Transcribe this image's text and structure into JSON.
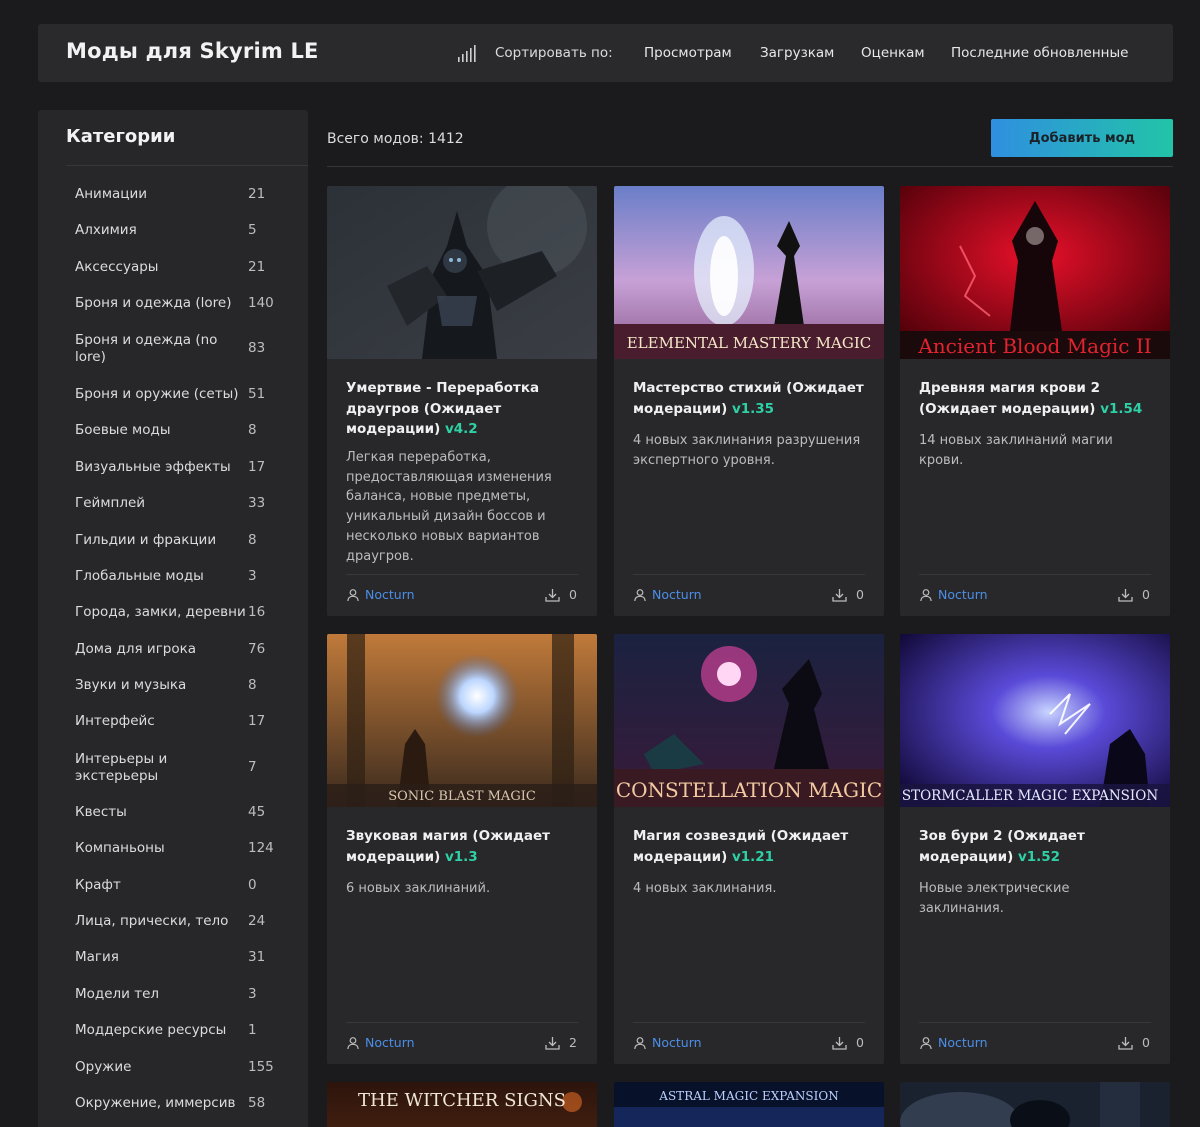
{
  "header": {
    "title": "Моды для Skyrim LE",
    "sort_label": "Сортировать по:",
    "sort_options": [
      "Просмотрам",
      "Загрузкам",
      "Оценкам",
      "Последние обновленные"
    ]
  },
  "sidebar": {
    "title": "Категории",
    "categories": [
      {
        "label": "Анимации",
        "count": "21"
      },
      {
        "label": "Алхимия",
        "count": "5"
      },
      {
        "label": "Аксессуары",
        "count": "21"
      },
      {
        "label": "Броня и одежда (lore)",
        "count": "140"
      },
      {
        "label": "Броня и одежда (no lore)",
        "count": "83"
      },
      {
        "label": "Броня и оружие (сеты)",
        "count": "51"
      },
      {
        "label": "Боевые моды",
        "count": "8"
      },
      {
        "label": "Визуальные эффекты",
        "count": "17"
      },
      {
        "label": "Геймплей",
        "count": "33"
      },
      {
        "label": "Гильдии и фракции",
        "count": "8"
      },
      {
        "label": "Глобальные моды",
        "count": "3"
      },
      {
        "label": "Города, замки, деревни",
        "count": "16"
      },
      {
        "label": "Дома для игрока",
        "count": "76"
      },
      {
        "label": "Звуки и музыка",
        "count": "8"
      },
      {
        "label": "Интерфейс",
        "count": "17"
      },
      {
        "label": "Интерьеры и экстерьеры",
        "count": "7"
      },
      {
        "label": "Квесты",
        "count": "45"
      },
      {
        "label": "Компаньоны",
        "count": "124"
      },
      {
        "label": "Крафт",
        "count": "0"
      },
      {
        "label": "Лица, прически, тело",
        "count": "24"
      },
      {
        "label": "Магия",
        "count": "31"
      },
      {
        "label": "Модели тел",
        "count": "3"
      },
      {
        "label": "Моддерские ресурсы",
        "count": "1"
      },
      {
        "label": "Оружие",
        "count": "155"
      },
      {
        "label": "Окружение, иммерсив",
        "count": "58"
      }
    ]
  },
  "main": {
    "total": "Всего модов: 1412",
    "add_button": "Добавить мод",
    "cards": [
      {
        "title": "Умертвие - Переработка драугров (Ожидает модерации)",
        "version": "v4.2",
        "description": "Легкая переработка, предоставляющая изменения баланса, новые предметы, уникальный дизайн боссов и несколько новых вариантов драугров.",
        "author": "Nocturn",
        "downloads": "0",
        "banner": ""
      },
      {
        "title": "Мастерство стихий (Ожидает модерации)",
        "version": "v1.35",
        "description": "4 новых заклинания разрушения экспертного уровня.",
        "author": "Nocturn",
        "downloads": "0",
        "banner": "ELEMENTAL MASTERY MAGIC"
      },
      {
        "title": "Древняя магия крови 2 (Ожидает модерации)",
        "version": "v1.54",
        "description": "14 новых заклинаний магии крови.",
        "author": "Nocturn",
        "downloads": "0",
        "banner": "Ancient Blood Magic II"
      },
      {
        "title": "Звуковая магия (Ожидает модерации)",
        "version": "v1.3",
        "description": "6 новых заклинаний.",
        "author": "Nocturn",
        "downloads": "2",
        "banner": "SONIC BLAST MAGIC"
      },
      {
        "title": "Магия созвездий (Ожидает модерации)",
        "version": "v1.21",
        "description": "4 новых заклинания.",
        "author": "Nocturn",
        "downloads": "0",
        "banner": "CONSTELLATION MAGIC"
      },
      {
        "title": "Зов бури 2 (Ожидает модерации)",
        "version": "v1.52",
        "description": "Новые электрические заклинания.",
        "author": "Nocturn",
        "downloads": "0",
        "banner": "STORMCALLER MAGIC EXPANSION"
      }
    ],
    "partial_banners": [
      "THE WITCHER SIGNS",
      "ASTRAL MAGIC EXPANSION",
      ""
    ]
  },
  "colors": {
    "accent_green": "#2ed0a5",
    "link_blue": "#4b8ee6",
    "button_gradient_start": "#2f8fe0",
    "button_gradient_end": "#22c4a8"
  },
  "icons": {
    "sort": "bar-chart-icon",
    "author": "user-icon",
    "downloads": "download-icon"
  }
}
